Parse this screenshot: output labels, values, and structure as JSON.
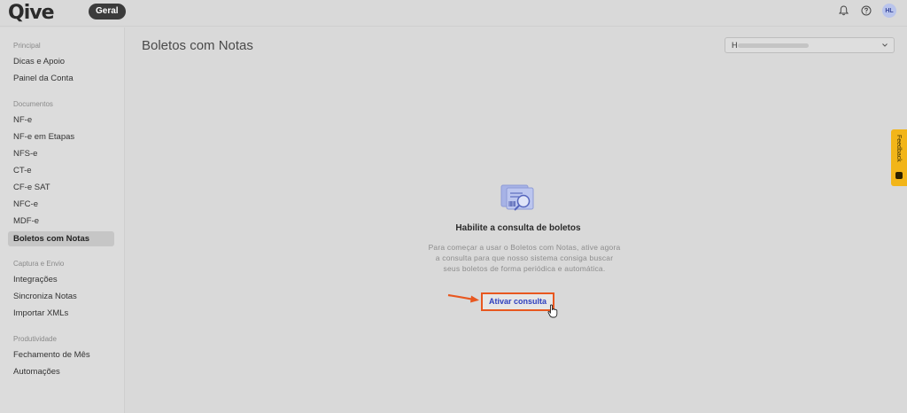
{
  "app": {
    "logo_text": "Qive",
    "workspace_badge": "Geral",
    "user_initials": "HL"
  },
  "icons": {
    "notifications": "bell-icon",
    "help": "question-circle-icon",
    "feedback": "feedback-icon"
  },
  "sidebar": {
    "sections": [
      {
        "label": "Principal"
      },
      {
        "label": "Documentos"
      },
      {
        "label": "Captura e Envio"
      },
      {
        "label": "Produtividade"
      }
    ],
    "items": [
      {
        "label": "Dicas e Apoio"
      },
      {
        "label": "Painel da Conta"
      },
      {
        "label": "NF-e"
      },
      {
        "label": "NF-e em Etapas"
      },
      {
        "label": "NFS-e"
      },
      {
        "label": "CT-e"
      },
      {
        "label": "CF-e SAT"
      },
      {
        "label": "NFC-e"
      },
      {
        "label": "MDF-e"
      },
      {
        "label": "Boletos com Notas",
        "active": true
      },
      {
        "label": "Integrações"
      },
      {
        "label": "Sincroniza Notas"
      },
      {
        "label": "Importar XMLs"
      },
      {
        "label": "Fechamento de Mês"
      },
      {
        "label": "Automações"
      }
    ]
  },
  "main": {
    "title": "Boletos com Notas",
    "company_selector": {
      "value": "H"
    },
    "empty_state": {
      "title": "Habilite a consulta de boletos",
      "description": "Para começar a usar o Boletos com Notas, ative agora a consulta para que nosso sistema consiga buscar seus boletos de forma periódica e automática.",
      "button_label": "Ativar consulta"
    }
  },
  "feedback": {
    "label": "Feedback"
  },
  "colors": {
    "highlight": "#e8571f",
    "link_blue": "#2d3fbf",
    "feedback_tab": "#f2b519"
  }
}
